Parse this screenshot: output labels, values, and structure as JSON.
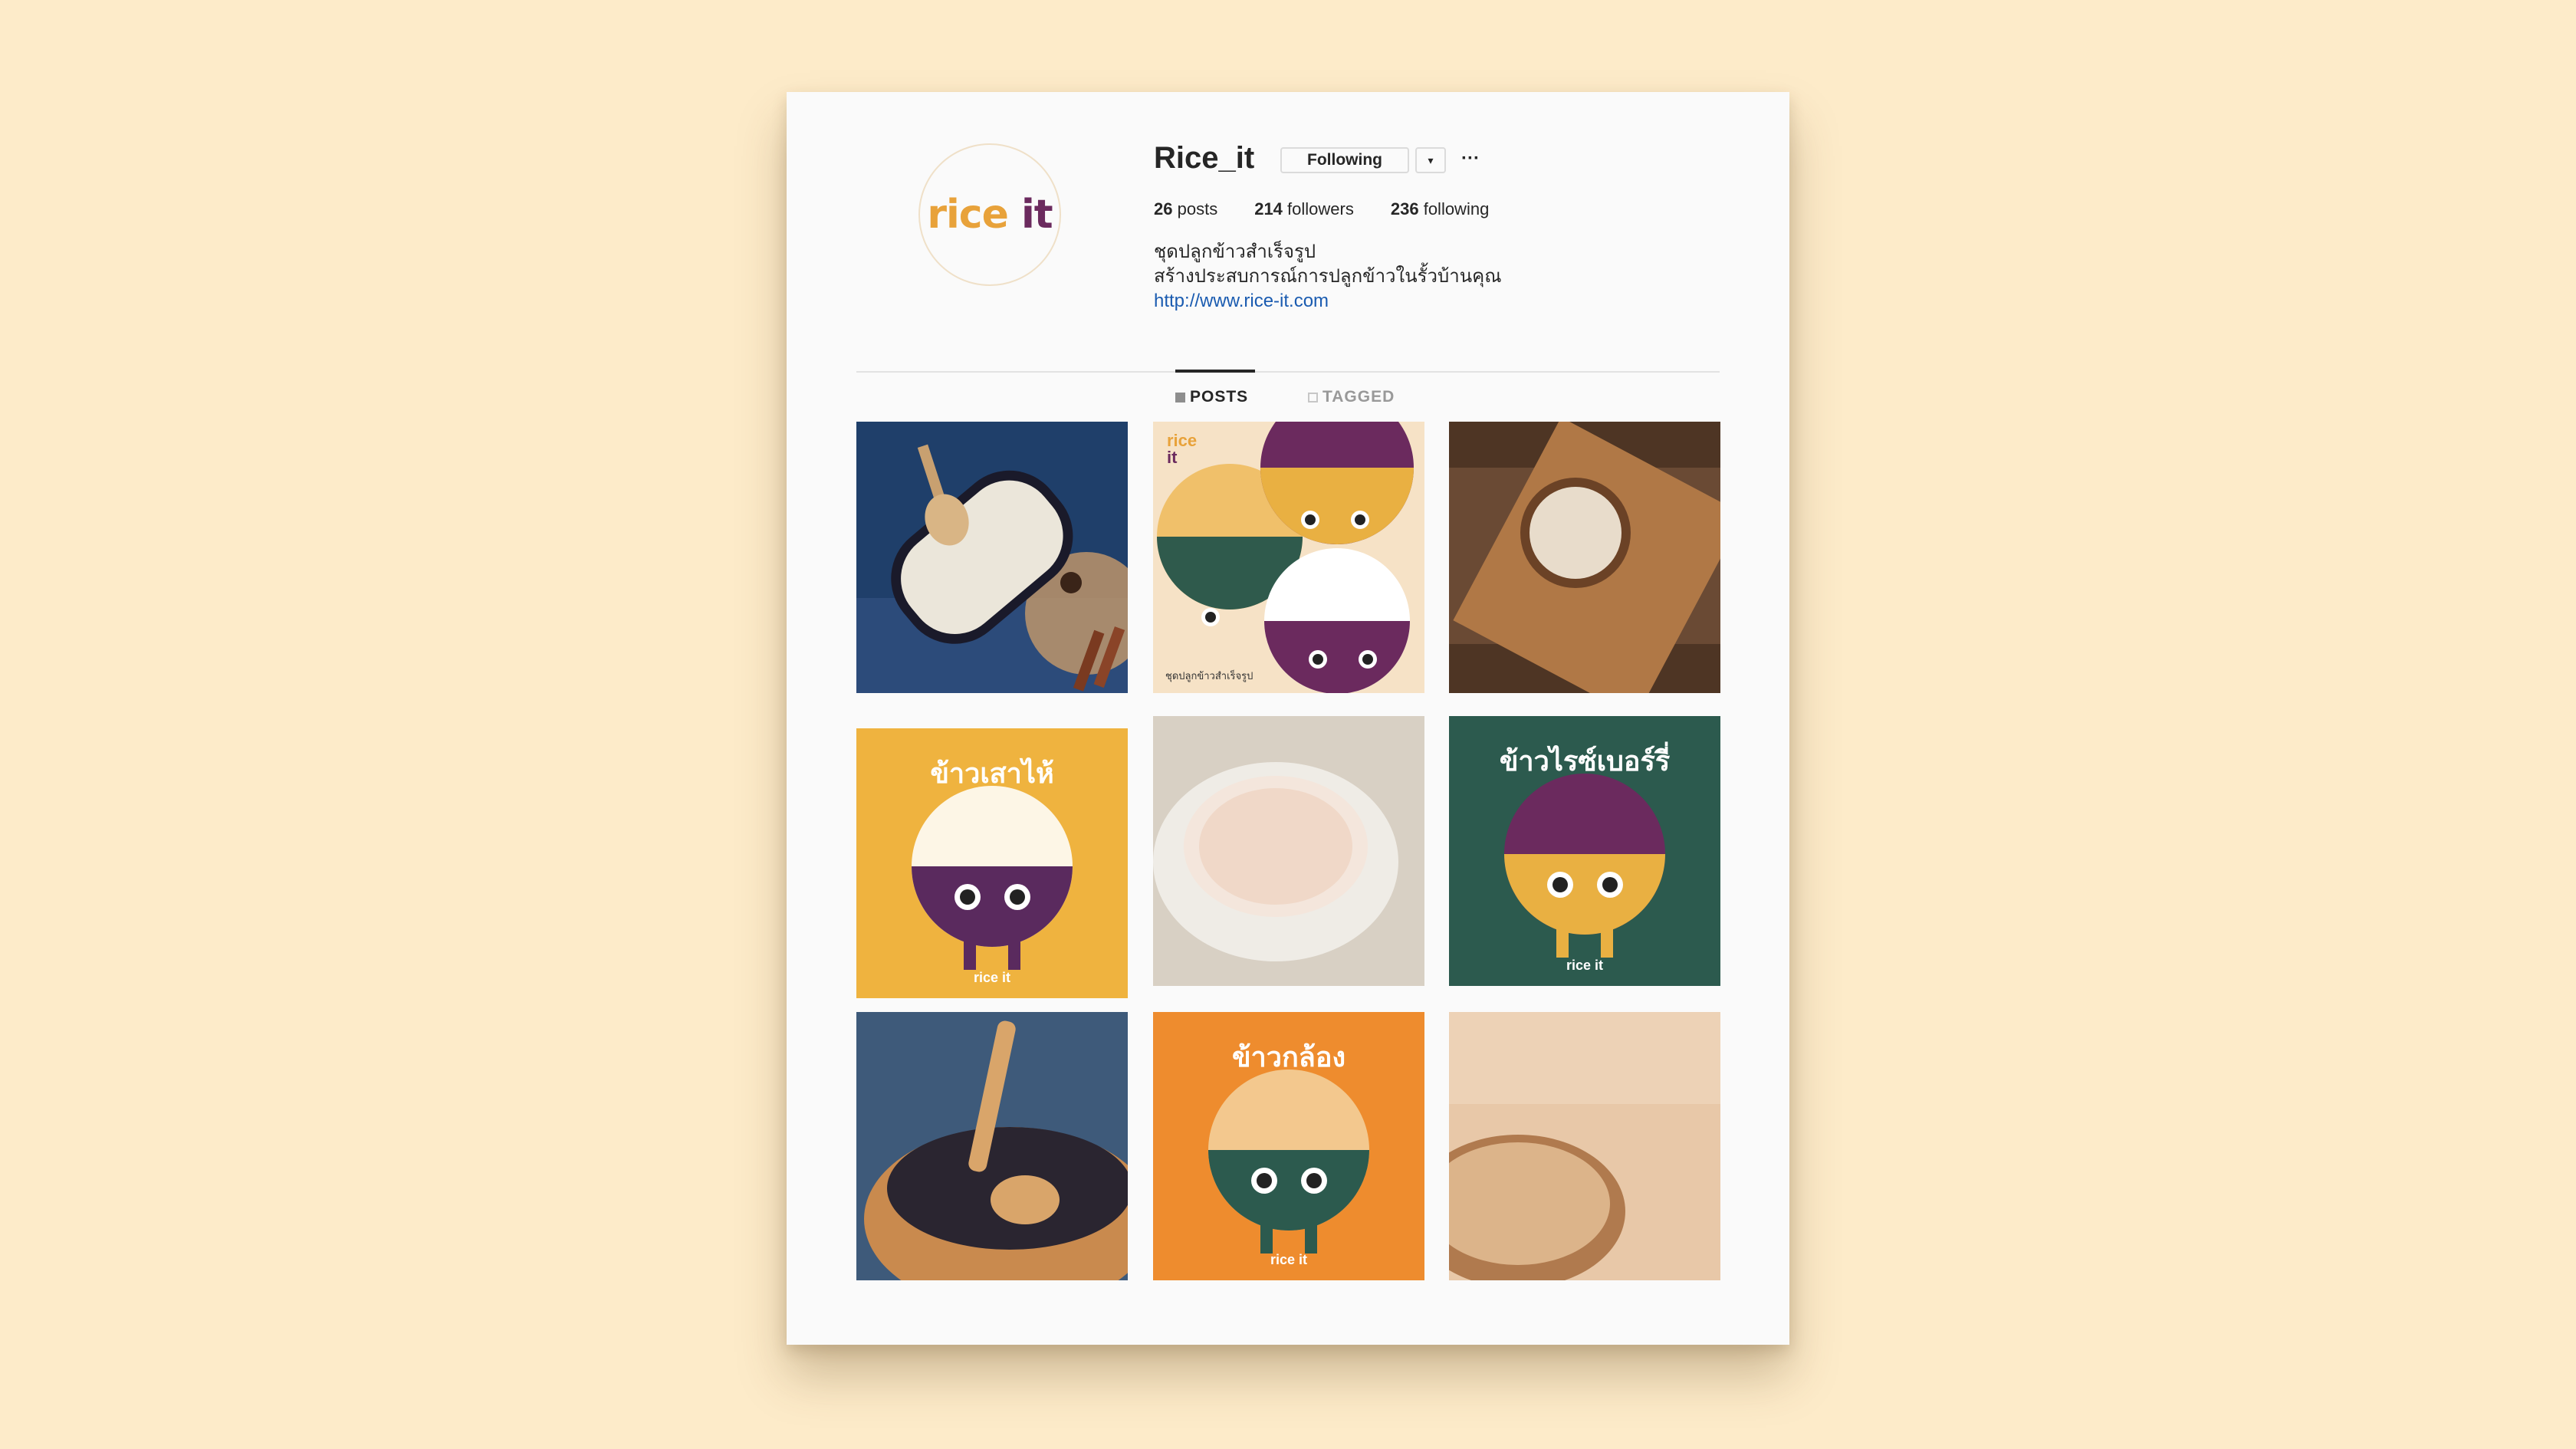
{
  "profile": {
    "username": "Rice_it",
    "follow_label": "Following",
    "dropdown_icon": "caret-down-icon",
    "more_label": "···",
    "avatar_logo_a": "rice",
    "avatar_logo_b": "it",
    "stats": {
      "posts_count": "26",
      "posts_label": "posts",
      "followers_count": "214",
      "followers_label": "followers",
      "following_count": "236",
      "following_label": "following"
    },
    "bio_line1": "ชุดปลูกข้าวสำเร็จรูป",
    "bio_line2": "สร้างประสบการณ์การปลูกข้าวในรั้วบ้านคุณ",
    "bio_link": "http://www.rice-it.com"
  },
  "tabs": {
    "posts": "POSTS",
    "tagged": "TAGGED"
  },
  "posts": [
    {
      "kind": "photo",
      "subject": "raw rice in pan with scoop"
    },
    {
      "kind": "illustration",
      "logo_a": "rice",
      "logo_b": "it",
      "caption": "ชุดปลูกข้าวสำเร็จรูป"
    },
    {
      "kind": "photo",
      "subject": "rice bowl on wooden board"
    },
    {
      "kind": "illustration",
      "title": "ข้าวเสาไห้",
      "footer": "rice it"
    },
    {
      "kind": "photo",
      "subject": "cooked rice in white bowl"
    },
    {
      "kind": "illustration",
      "title": "ข้าวไรซ์เบอร์รี่",
      "footer": "rice it"
    },
    {
      "kind": "photo",
      "subject": "black rice in wooden bowl"
    },
    {
      "kind": "illustration",
      "title": "ข้าวกล้อง",
      "footer": "rice it"
    },
    {
      "kind": "photo",
      "subject": "brown rice on wooden spoon"
    }
  ],
  "colors": {
    "background": "#fdebc9",
    "brand_orange": "#e8a23a",
    "brand_purple": "#6b2a5e",
    "tile_yellow": "#efb33f",
    "tile_green": "#2c5a4e",
    "tile_orange": "#ee8c2e",
    "link": "#1a5bb0"
  }
}
